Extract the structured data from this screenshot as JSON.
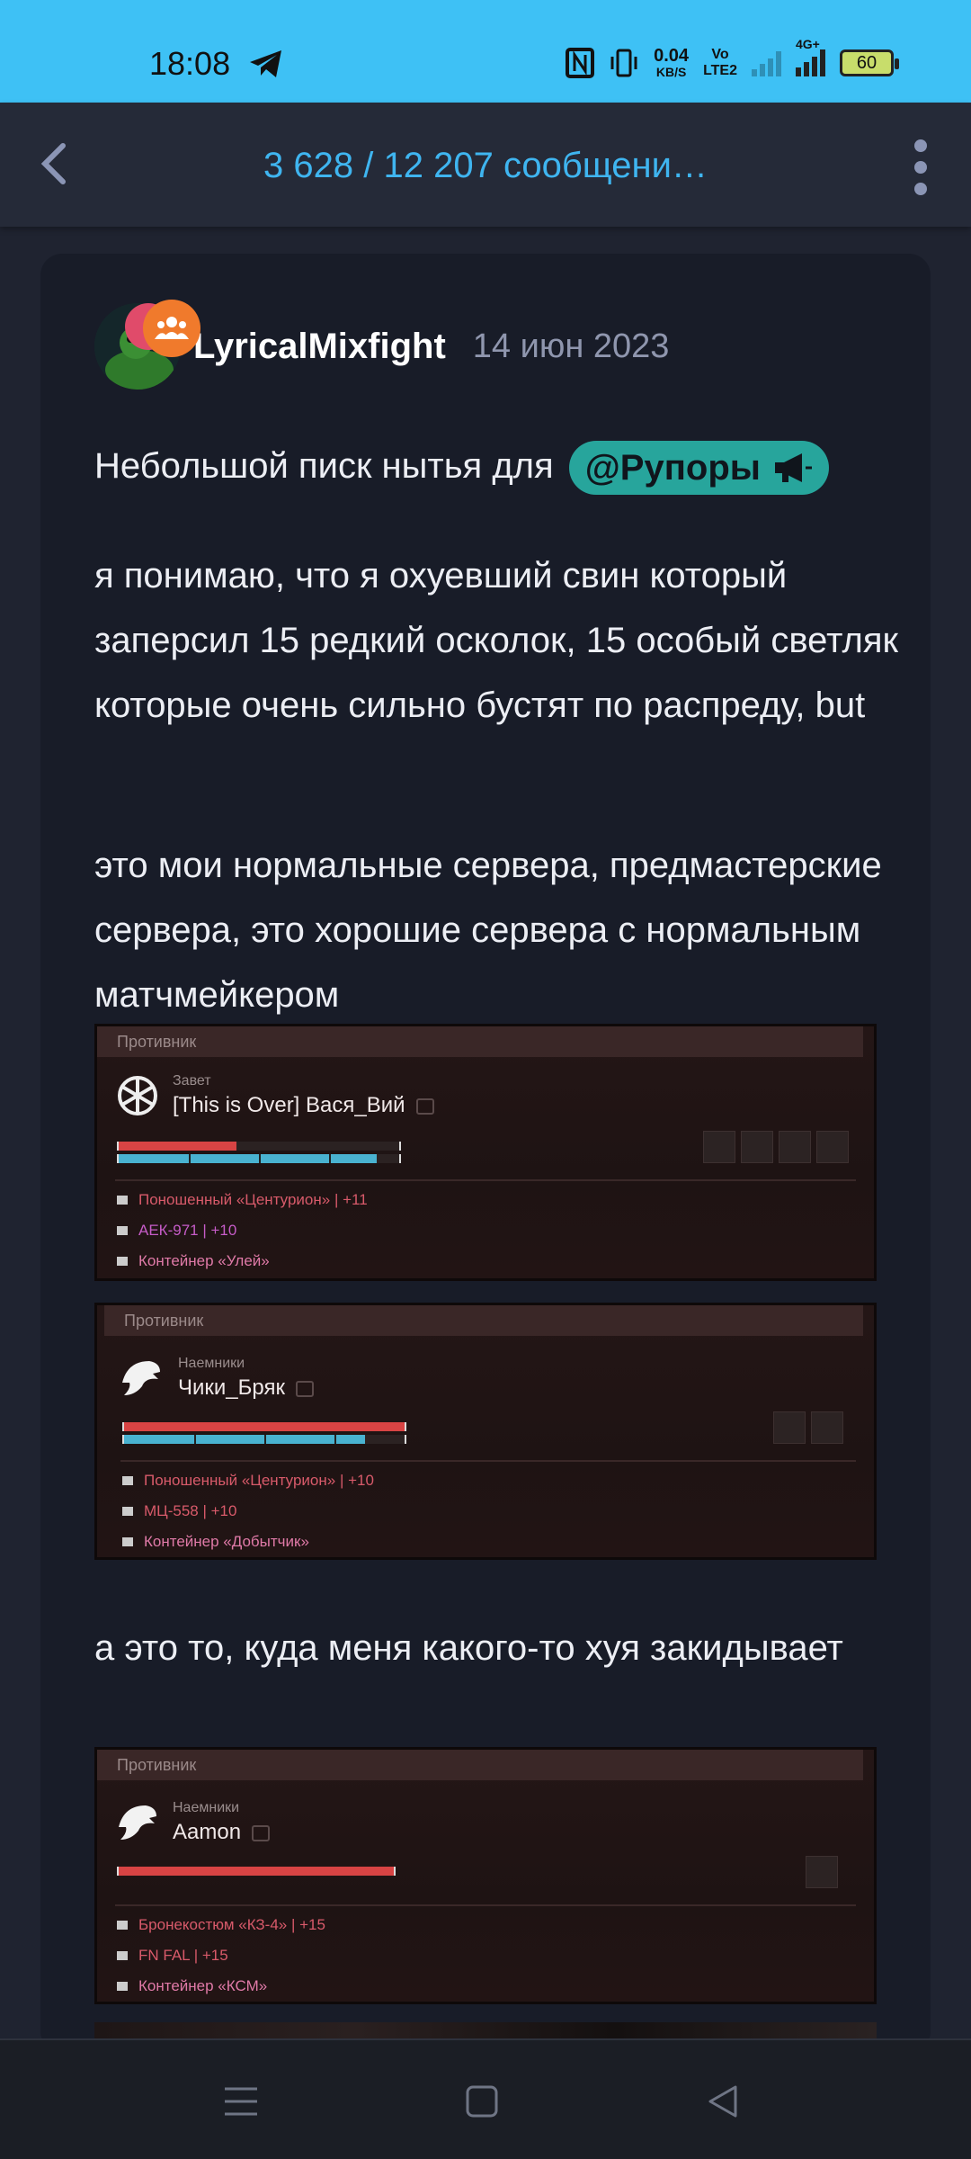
{
  "status_bar": {
    "time": "18:08",
    "network_speed_value": "0.04",
    "network_speed_unit": "KB/S",
    "volte_top": "Vo",
    "volte_bottom": "LTE2",
    "network_type": "4G+",
    "battery_level": "60"
  },
  "header": {
    "title": "3 628 / 12 207 сообщени…"
  },
  "post": {
    "author": "LyricalMixfight",
    "date": "14 июн 2023",
    "intro_text": "Небольшой писк нытья для",
    "mention_tag": "@Рупоры",
    "paragraph1": "я понимаю, что я охуевший свин который заперсил 15 редкий осколок, 15 особый светляк которые очень сильно бустят по распреду, but",
    "paragraph2": "это мои нормальные сервера, предмастерские сервера, это хорошие сервера с нормальным матчмейкером",
    "paragraph3": "а это то, куда меня какого-то хуя закидывает"
  },
  "screenshots": [
    {
      "header": "Противник",
      "faction": "Завет",
      "player": "[This is Over] Вася_Вий",
      "hp_fraction": 0.42,
      "armor_fraction": 0.92,
      "gear": [
        "Поношенный «Центурион» | +11",
        "АЕК-971 | +10",
        "Контейнер «Улей»"
      ]
    },
    {
      "header": "Противник",
      "faction": "Наемники",
      "player": "Чики_Бряк",
      "hp_fraction": 1.0,
      "armor_fraction": 0.86,
      "gear": [
        "Поношенный «Центурион» | +10",
        "МЦ-558 | +10",
        "Контейнер «Добытчик»"
      ]
    },
    {
      "header": "Противник",
      "faction": "Наемники",
      "player": "Aamon",
      "hp_fraction": 1.0,
      "gear": [
        "Бронекостюм «КЗ-4» | +15",
        "FN FAL | +15",
        "Контейнер «КСМ»"
      ]
    }
  ],
  "icons": {
    "telegram": "telegram-icon",
    "nfc": "nfc-icon",
    "vibrate": "vibrate-icon",
    "back": "back-arrow-icon",
    "more": "more-vertical-icon",
    "megaphone": "megaphone-icon",
    "group": "group-icon",
    "nav_menu": "menu-icon",
    "nav_home": "home-square-icon",
    "nav_back": "back-triangle-icon"
  },
  "colors": {
    "status_bar": "#3ec1f5",
    "header_title": "#3fb5f0",
    "tag_bg": "#27a59c",
    "hp": "#d84444",
    "armor": "#49b2d0"
  }
}
